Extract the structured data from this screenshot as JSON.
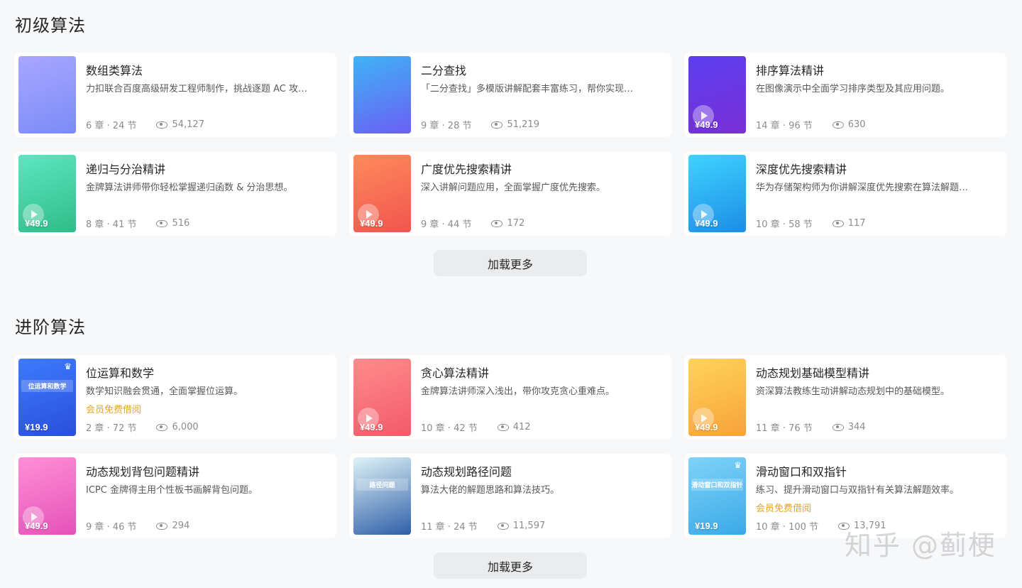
{
  "sections": [
    {
      "title": "初级算法",
      "load_more": "加载更多",
      "cards": [
        {
          "title": "数组类算法",
          "desc": "力扣联合百度高级研发工程师制作，挑战逐题 AC 攻…",
          "chapters": "6 章 · 24 节",
          "views": "54,127",
          "price": "",
          "tag": "",
          "cover_colors": [
            "#a9a6ff",
            "#7b8cf7"
          ],
          "play": false,
          "crown": false,
          "cover_text": ""
        },
        {
          "title": "二分查找",
          "desc": "「二分查找」多模版讲解配套丰富练习，帮你实现…",
          "chapters": "9 章 · 28 节",
          "views": "51,219",
          "price": "",
          "tag": "",
          "cover_colors": [
            "#3fb3f5",
            "#6b5ff5"
          ],
          "play": false,
          "crown": false,
          "cover_text": ""
        },
        {
          "title": "排序算法精讲",
          "desc": "在图像演示中全面学习排序类型及其应用问题。",
          "chapters": "14 章 · 96 节",
          "views": "630",
          "price": "¥49.9",
          "tag": "",
          "cover_colors": [
            "#5a3ef0",
            "#7a2fd6"
          ],
          "play": true,
          "crown": false,
          "cover_text": ""
        },
        {
          "title": "递归与分治精讲",
          "desc": "金牌算法讲师带你轻松掌握递归函数 & 分治思想。",
          "chapters": "8 章 · 41 节",
          "views": "516",
          "price": "¥49.9",
          "tag": "",
          "cover_colors": [
            "#5ee6c1",
            "#2fbd88"
          ],
          "play": true,
          "crown": false,
          "cover_text": ""
        },
        {
          "title": "广度优先搜索精讲",
          "desc": "深入讲解问题应用，全面掌握广度优先搜索。",
          "chapters": "9 章 · 44 节",
          "views": "172",
          "price": "¥49.9",
          "tag": "",
          "cover_colors": [
            "#ff8a5c",
            "#f0554f"
          ],
          "play": true,
          "crown": false,
          "cover_text": ""
        },
        {
          "title": "深度优先搜索精讲",
          "desc": "华为存储架构师为你讲解深度优先搜索在算法解题…",
          "chapters": "10 章 · 58 节",
          "views": "117",
          "price": "¥49.9",
          "tag": "",
          "cover_colors": [
            "#3fd3ff",
            "#1c8de6"
          ],
          "play": true,
          "crown": false,
          "cover_text": ""
        }
      ]
    },
    {
      "title": "进阶算法",
      "load_more": "加载更多",
      "cards": [
        {
          "title": "位运算和数学",
          "desc": "数学知识融会贯通，全面掌握位运算。",
          "chapters": "2 章 · 72 节",
          "views": "6,000",
          "price": "¥19.9",
          "tag": "会员免费借阅",
          "cover_colors": [
            "#3d7bff",
            "#2a4fd8"
          ],
          "play": false,
          "crown": true,
          "cover_text": "位运算和数学"
        },
        {
          "title": "贪心算法精讲",
          "desc": "金牌算法讲师深入浅出，带你攻克贪心重难点。",
          "chapters": "10 章 · 42 节",
          "views": "412",
          "price": "¥49.9",
          "tag": "",
          "cover_colors": [
            "#ff8c8c",
            "#f25a6a"
          ],
          "play": true,
          "crown": false,
          "cover_text": ""
        },
        {
          "title": "动态规划基础模型精讲",
          "desc": "资深算法教练生动讲解动态规划中的基础模型。",
          "chapters": "11 章 · 76 节",
          "views": "344",
          "price": "¥49.9",
          "tag": "",
          "cover_colors": [
            "#ffd45a",
            "#f7a23a"
          ],
          "play": true,
          "crown": false,
          "cover_text": ""
        },
        {
          "title": "动态规划背包问题精讲",
          "desc": "ICPC 金牌得主用个性板书画解背包问题。",
          "chapters": "9 章 · 46 节",
          "views": "294",
          "price": "¥49.9",
          "tag": "",
          "cover_colors": [
            "#ff8fd6",
            "#e552b8"
          ],
          "play": true,
          "crown": false,
          "cover_text": ""
        },
        {
          "title": "动态规划路径问题",
          "desc": "算法大佬的解题思路和算法技巧。",
          "chapters": "11 章 · 24 节",
          "views": "11,597",
          "price": "",
          "tag": "",
          "cover_colors": [
            "#dff3f7",
            "#2f5fa8"
          ],
          "play": false,
          "crown": false,
          "cover_text": "路径问题"
        },
        {
          "title": "滑动窗口和双指针",
          "desc": "练习、提升滑动窗口与双指针有关算法解题效率。",
          "chapters": "10 章 · 100 节",
          "views": "13,791",
          "price": "¥19.9",
          "tag": "会员免费借阅",
          "cover_colors": [
            "#7fd3f7",
            "#3aa9e8"
          ],
          "play": false,
          "crown": true,
          "cover_text": "滑动窗口和双指针"
        }
      ]
    }
  ],
  "watermark": "知乎 @蓟梗"
}
